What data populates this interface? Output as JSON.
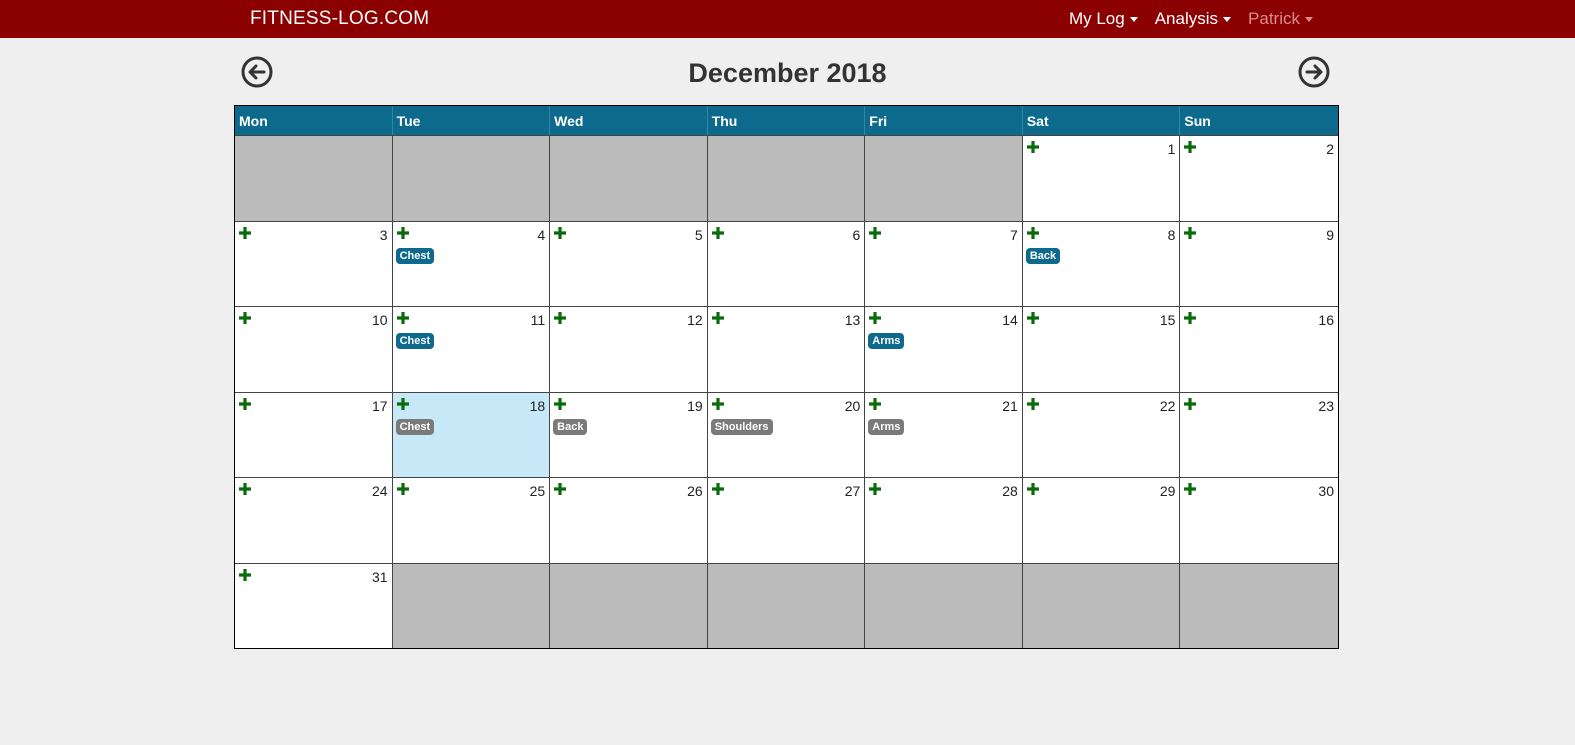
{
  "navbar": {
    "brand": "FITNESS-LOG.COM",
    "menu": [
      {
        "label": "My Log"
      },
      {
        "label": "Analysis"
      },
      {
        "label": "Patrick"
      }
    ]
  },
  "calendar": {
    "title": "December 2018",
    "weekdays": [
      "Mon",
      "Tue",
      "Wed",
      "Thu",
      "Fri",
      "Sat",
      "Sun"
    ],
    "days": [
      {
        "empty": true
      },
      {
        "empty": true
      },
      {
        "empty": true
      },
      {
        "empty": true
      },
      {
        "empty": true
      },
      {
        "num": "1"
      },
      {
        "num": "2"
      },
      {
        "num": "3"
      },
      {
        "num": "4",
        "tag": "Chest",
        "status": "done"
      },
      {
        "num": "5"
      },
      {
        "num": "6"
      },
      {
        "num": "7"
      },
      {
        "num": "8",
        "tag": "Back",
        "status": "done"
      },
      {
        "num": "9"
      },
      {
        "num": "10"
      },
      {
        "num": "11",
        "tag": "Chest",
        "status": "done"
      },
      {
        "num": "12"
      },
      {
        "num": "13"
      },
      {
        "num": "14",
        "tag": "Arms",
        "status": "done"
      },
      {
        "num": "15"
      },
      {
        "num": "16"
      },
      {
        "num": "17"
      },
      {
        "num": "18",
        "tag": "Chest",
        "status": "plan",
        "today": true
      },
      {
        "num": "19",
        "tag": "Back",
        "status": "plan"
      },
      {
        "num": "20",
        "tag": "Shoulders",
        "status": "plan"
      },
      {
        "num": "21",
        "tag": "Arms",
        "status": "plan"
      },
      {
        "num": "22"
      },
      {
        "num": "23"
      },
      {
        "num": "24"
      },
      {
        "num": "25"
      },
      {
        "num": "26"
      },
      {
        "num": "27"
      },
      {
        "num": "28"
      },
      {
        "num": "29"
      },
      {
        "num": "30"
      },
      {
        "num": "31"
      },
      {
        "empty": true
      },
      {
        "empty": true
      },
      {
        "empty": true
      },
      {
        "empty": true
      },
      {
        "empty": true
      },
      {
        "empty": true
      }
    ]
  },
  "colors": {
    "navbar": "#8b0000",
    "header": "#0e6a8c",
    "today": "#c6e8f7",
    "empty_day": "#bbbbbb",
    "add_icon": "#0a6b0a",
    "planned_tag": "#7a7a7a"
  },
  "icons": {
    "prev": "arrow-left-circle-icon",
    "next": "arrow-right-circle-icon",
    "add": "plus-icon"
  }
}
